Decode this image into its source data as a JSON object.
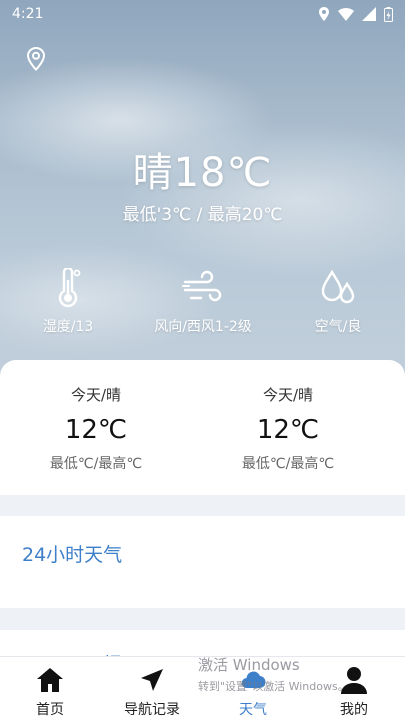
{
  "status_bar": {
    "time": "4:21"
  },
  "current": {
    "condition_temp": "晴18℃",
    "range": "最低'3℃ / 最高20℃"
  },
  "metrics": [
    {
      "label": "湿度/13",
      "icon": "thermometer-icon"
    },
    {
      "label": "风向/西风1-2级",
      "icon": "wind-icon"
    },
    {
      "label": "空气/良",
      "icon": "water-drops-icon"
    }
  ],
  "forecast": [
    {
      "title": "今天/晴",
      "temp": "12℃",
      "range": "最低℃/最高℃"
    },
    {
      "title": "今天/晴",
      "temp": "12℃",
      "range": "最低℃/最高℃"
    }
  ],
  "hourly": {
    "title": "24小时天气"
  },
  "next_section": {
    "title": "三天预报"
  },
  "nav": [
    {
      "label": "首页",
      "icon": "home-icon"
    },
    {
      "label": "导航记录",
      "icon": "navigation-arrow-icon"
    },
    {
      "label": "天气",
      "icon": "weather-icon"
    },
    {
      "label": "我的",
      "icon": "user-icon"
    }
  ],
  "watermark": {
    "title": "激活 Windows",
    "subtitle": "转到\"设置\"以激活 Windows。"
  },
  "colors": {
    "accent": "#3e7fc9",
    "text_primary": "#222222"
  }
}
